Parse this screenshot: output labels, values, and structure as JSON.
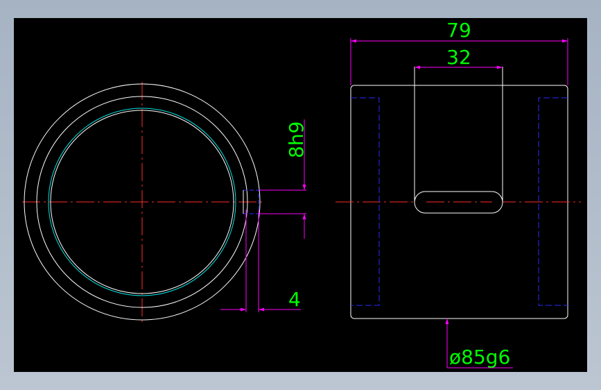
{
  "colors": {
    "background": "#000000",
    "frame": "#b4bfcc",
    "outline": "#ffffff",
    "centerline": "#ff2a2a",
    "dimension": "#ff00ff",
    "dimension_text": "#00ff00",
    "hidden": "#2a2aff",
    "inner_edge": "#00e5e5"
  },
  "dimensions": {
    "overall_width": "79",
    "slot_width": "32",
    "keyway_width": "8h9",
    "keyway_depth": "4",
    "outer_diameter": "ø85g6"
  }
}
